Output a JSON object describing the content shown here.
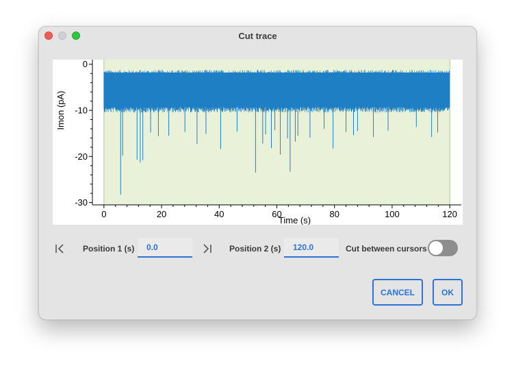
{
  "window": {
    "title": "Cut trace"
  },
  "chart_data": {
    "type": "line",
    "xlabel": "Time (s)",
    "ylabel": "Imon (pA)",
    "xlim": [
      -4,
      124
    ],
    "ylim": [
      -30.5,
      1
    ],
    "x_ticks": [
      0,
      20,
      40,
      60,
      80,
      100,
      120
    ],
    "y_ticks": [
      0,
      -10,
      -20,
      -30
    ],
    "background": "#e9f2d8",
    "series_color": "#1f7fc4",
    "series": [
      {
        "x_range": [
          0,
          120
        ],
        "noise_band": [
          -9.5,
          -2
        ],
        "events": [
          {
            "x": 5.8,
            "y": -28.3
          },
          {
            "x": 6.5,
            "y": -19.8
          },
          {
            "x": 11.5,
            "y": -20.7
          },
          {
            "x": 12.6,
            "y": -21.3
          },
          {
            "x": 13.5,
            "y": -20.8
          },
          {
            "x": 16.2,
            "y": -14.8
          },
          {
            "x": 18.9,
            "y": -15.6
          },
          {
            "x": 22.5,
            "y": -15.5
          },
          {
            "x": 28.1,
            "y": -14.7
          },
          {
            "x": 32.3,
            "y": -17.3
          },
          {
            "x": 35.4,
            "y": -15.1
          },
          {
            "x": 40.5,
            "y": -18.4
          },
          {
            "x": 46.2,
            "y": -14.6
          },
          {
            "x": 52.6,
            "y": -23.5
          },
          {
            "x": 55.1,
            "y": -17.2
          },
          {
            "x": 56.1,
            "y": -15.2
          },
          {
            "x": 58.1,
            "y": -18.2
          },
          {
            "x": 59.3,
            "y": -14.3
          },
          {
            "x": 61.2,
            "y": -19.6
          },
          {
            "x": 63.7,
            "y": -16.1
          },
          {
            "x": 64.6,
            "y": -23.3
          },
          {
            "x": 66.4,
            "y": -16.8
          },
          {
            "x": 67.3,
            "y": -15.5
          },
          {
            "x": 71.5,
            "y": -15.9
          },
          {
            "x": 76.4,
            "y": -14.0
          },
          {
            "x": 79.5,
            "y": -18.3
          },
          {
            "x": 84.0,
            "y": -14.7
          },
          {
            "x": 86.6,
            "y": -15.4
          },
          {
            "x": 88.0,
            "y": -14.5
          },
          {
            "x": 93.5,
            "y": -15.8
          },
          {
            "x": 98.6,
            "y": -14.4
          },
          {
            "x": 108.4,
            "y": -13.6
          },
          {
            "x": 113.7,
            "y": -15.8
          },
          {
            "x": 115.8,
            "y": -14.8
          }
        ]
      }
    ]
  },
  "controls": {
    "first_icon": "skip-to-start-icon",
    "last_icon": "skip-to-end-icon",
    "position1_label": "Position 1 (s)",
    "position1_value": "0.0",
    "position2_label": "Position 2 (s)",
    "position2_value": "120.0",
    "cut_between_label": "Cut between cursors",
    "cut_between_enabled": false
  },
  "buttons": {
    "cancel": "CANCEL",
    "ok": "OK"
  }
}
